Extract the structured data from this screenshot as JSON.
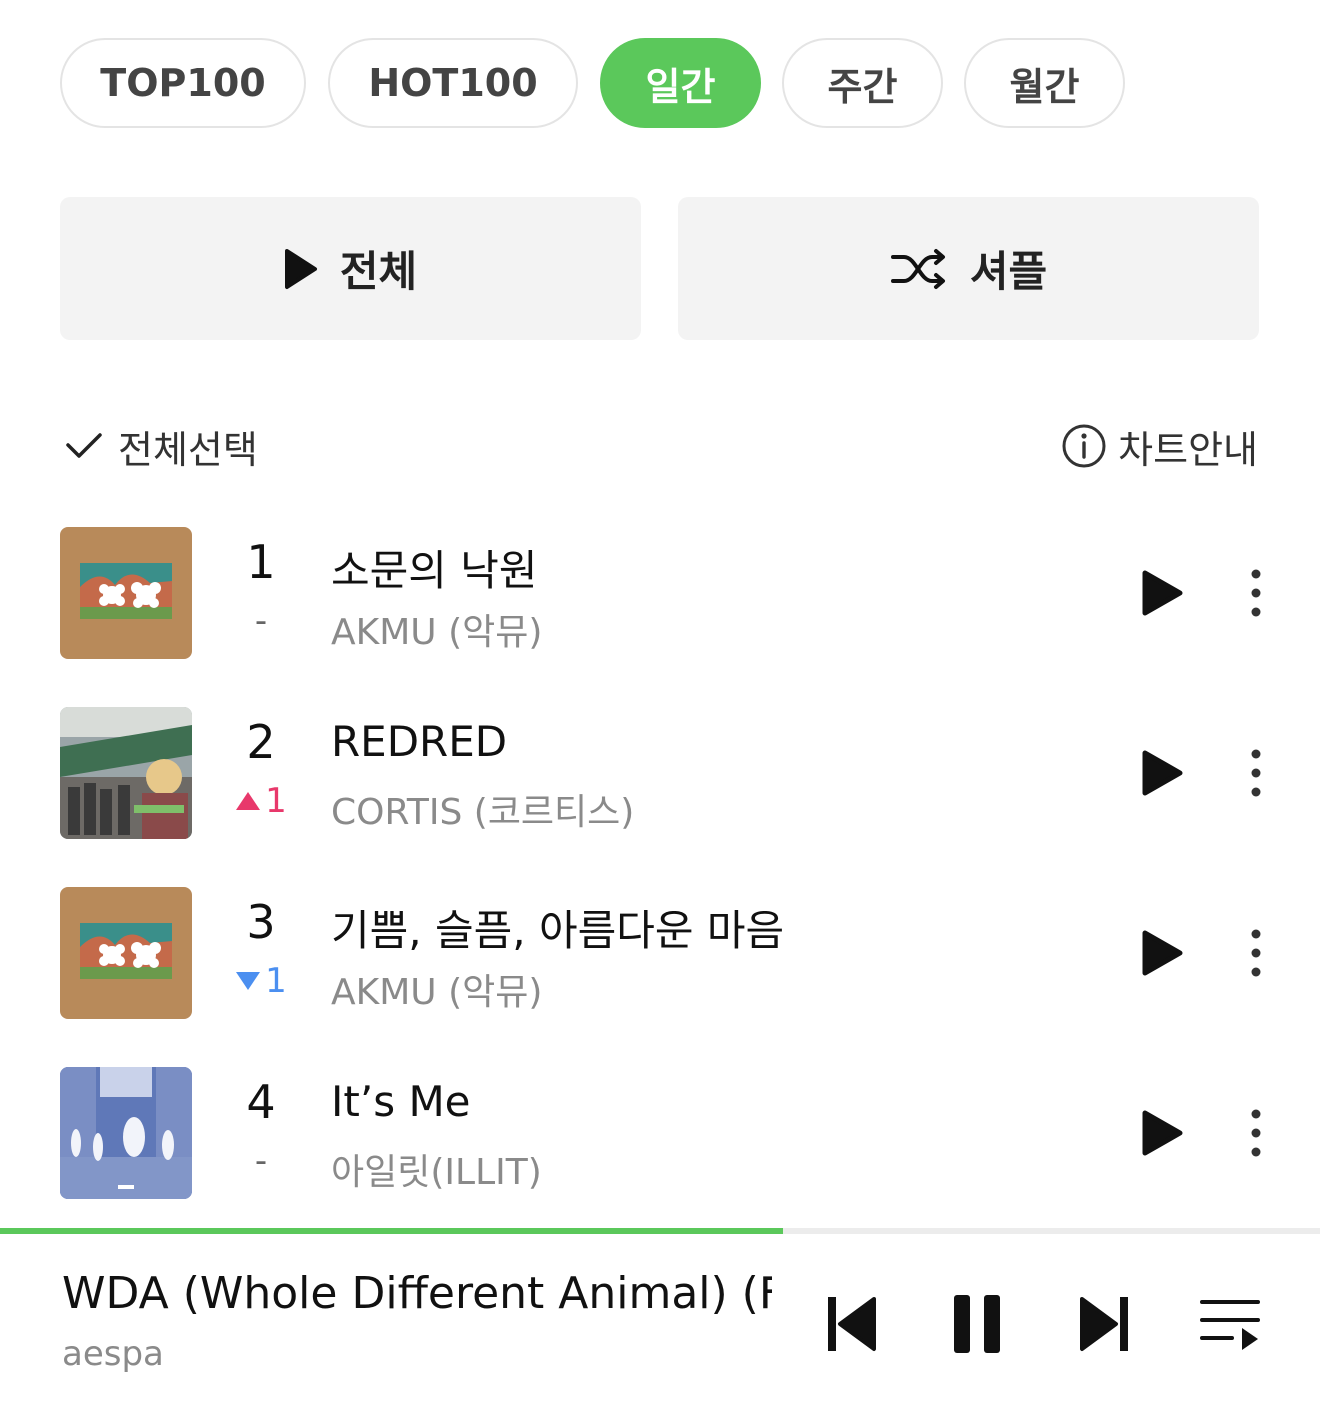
{
  "filters": [
    {
      "label": "TOP100",
      "active": false
    },
    {
      "label": "HOT100",
      "active": false
    },
    {
      "label": "일간",
      "active": true
    },
    {
      "label": "주간",
      "active": false
    },
    {
      "label": "월간",
      "active": false
    }
  ],
  "actions": {
    "play_all_label": "전체",
    "shuffle_label": "셔플"
  },
  "list_header": {
    "select_all_label": "전체선택",
    "chart_guide_label": "차트안내"
  },
  "tracks": [
    {
      "rank": "1",
      "change": "-",
      "change_dir": "same",
      "title": "소문의 낙원",
      "artist": "AKMU (악뮤)",
      "cover_icon": "akmu-album-cover"
    },
    {
      "rank": "2",
      "change": "1",
      "change_dir": "up",
      "title": "REDRED",
      "artist": "CORTIS (코르티스)",
      "cover_icon": "cortis-album-cover"
    },
    {
      "rank": "3",
      "change": "1",
      "change_dir": "down",
      "title": "기쁨, 슬픔, 아름다운 마음",
      "artist": "AKMU (악뮤)",
      "cover_icon": "akmu-album-cover"
    },
    {
      "rank": "4",
      "change": "-",
      "change_dir": "same",
      "title": "It’s Me",
      "artist": "아일릿(ILLIT)",
      "cover_icon": "illit-album-cover"
    }
  ],
  "player": {
    "title": "WDA (Whole Different Animal) (F...",
    "artist": "aespa",
    "progress": 0.593
  },
  "colors": {
    "accent": "#5bc85b",
    "rank_up": "#e8386b",
    "rank_down": "#4b8ff0"
  }
}
